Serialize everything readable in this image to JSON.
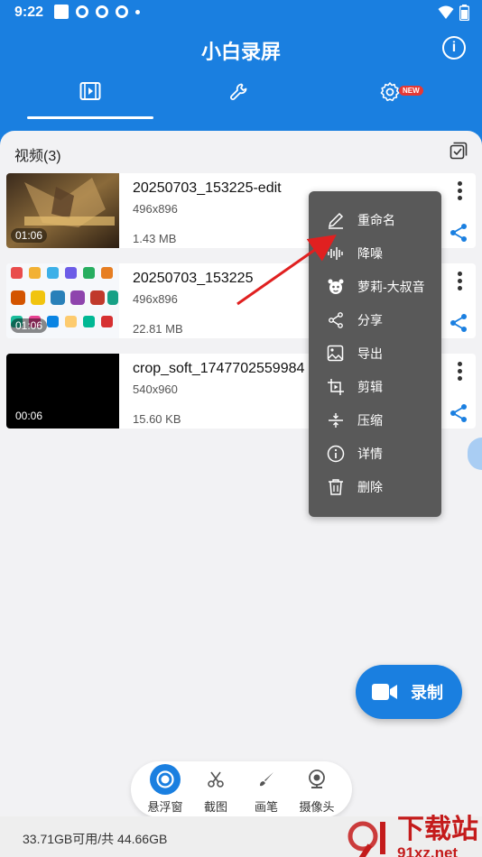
{
  "status": {
    "time": "9:22"
  },
  "app": {
    "title": "小白录屏"
  },
  "tabs": [
    {
      "name": "videos"
    },
    {
      "name": "tools"
    },
    {
      "name": "settings",
      "badge": "NEW"
    }
  ],
  "section": {
    "title": "视频(3)"
  },
  "videos": [
    {
      "name": "20250703_153225-edit",
      "resolution": "496x896",
      "size": "1.43 MB",
      "duration": "01:06"
    },
    {
      "name": "20250703_153225",
      "resolution": "496x896",
      "size": "22.81 MB",
      "duration": "01:06"
    },
    {
      "name": "crop_soft_1747702559984",
      "resolution": "540x960",
      "size": "15.60 KB",
      "duration": "00:06"
    }
  ],
  "menu": {
    "items": [
      {
        "label": "重命名",
        "icon": "pencil-icon"
      },
      {
        "label": "降噪",
        "icon": "waveform-icon"
      },
      {
        "label": "萝莉-大叔音",
        "icon": "voice-face-icon"
      },
      {
        "label": "分享",
        "icon": "share-icon"
      },
      {
        "label": "导出",
        "icon": "export-image-icon"
      },
      {
        "label": "剪辑",
        "icon": "crop-icon"
      },
      {
        "label": "压缩",
        "icon": "compress-icon"
      },
      {
        "label": "详情",
        "icon": "info-icon"
      },
      {
        "label": "删除",
        "icon": "trash-icon"
      }
    ]
  },
  "record": {
    "label": "录制"
  },
  "tools": [
    {
      "label": "悬浮窗",
      "icon": "float-window-icon"
    },
    {
      "label": "截图",
      "icon": "scissors-icon"
    },
    {
      "label": "画笔",
      "icon": "brush-icon"
    },
    {
      "label": "摄像头",
      "icon": "camera-icon"
    }
  ],
  "footer": {
    "storage": "33.71GB可用/共 44.66GB"
  },
  "watermark": {
    "line1": "下载站",
    "line2": "91xz.net"
  },
  "colors": {
    "primary": "#1a7fe0",
    "menu_bg": "#595959",
    "arrow": "#e02020",
    "watermark": "#c41b1b"
  }
}
